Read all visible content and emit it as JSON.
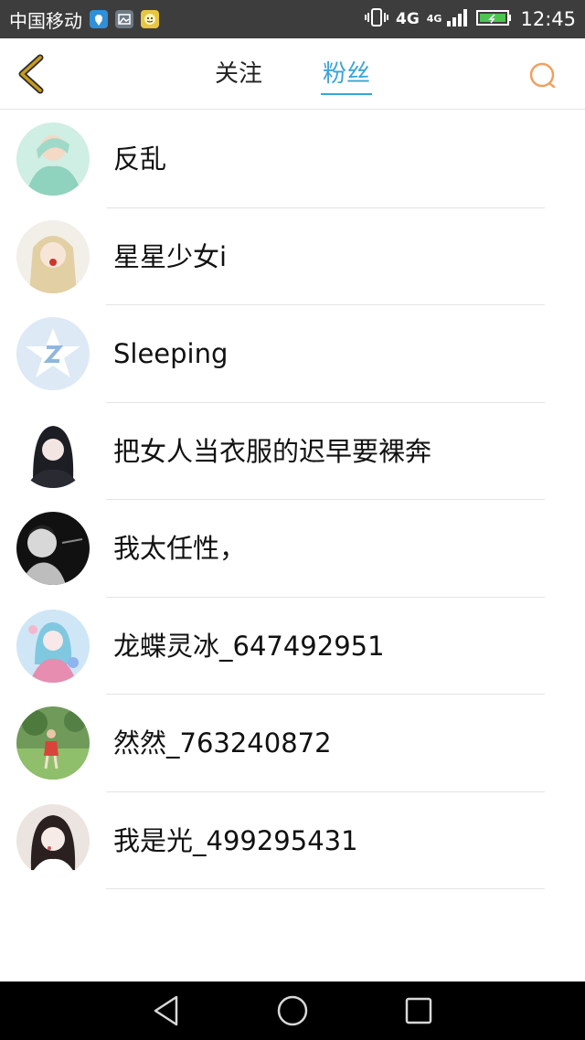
{
  "status_bar": {
    "carrier": "中国移动",
    "network_primary": "4G",
    "network_secondary": "4G",
    "time": "12:45",
    "icons": [
      "location-icon",
      "image-icon",
      "emoji-app-icon",
      "vibrate-icon",
      "signal-icon",
      "battery-icon"
    ]
  },
  "header": {
    "back_icon": "chevron-left-icon",
    "tabs": [
      {
        "label": "关注",
        "active": false
      },
      {
        "label": "粉丝",
        "active": true
      }
    ],
    "search_icon": "search-icon",
    "accent_color": "#3aa4d8",
    "back_color": "#c99a1c",
    "search_color": "#f0a060"
  },
  "fans": [
    {
      "name": "反乱"
    },
    {
      "name": "星星少女i"
    },
    {
      "name": "Sleeping"
    },
    {
      "name": "把女人当衣服的迟早要裸奔"
    },
    {
      "name": "我太任性，"
    },
    {
      "name": "龙蝶灵冰_647492951"
    },
    {
      "name": "然然_763240872"
    },
    {
      "name": "我是光_499295431"
    }
  ],
  "nav_bar": {
    "buttons": [
      "back-triangle-icon",
      "home-circle-icon",
      "recent-square-icon"
    ]
  }
}
